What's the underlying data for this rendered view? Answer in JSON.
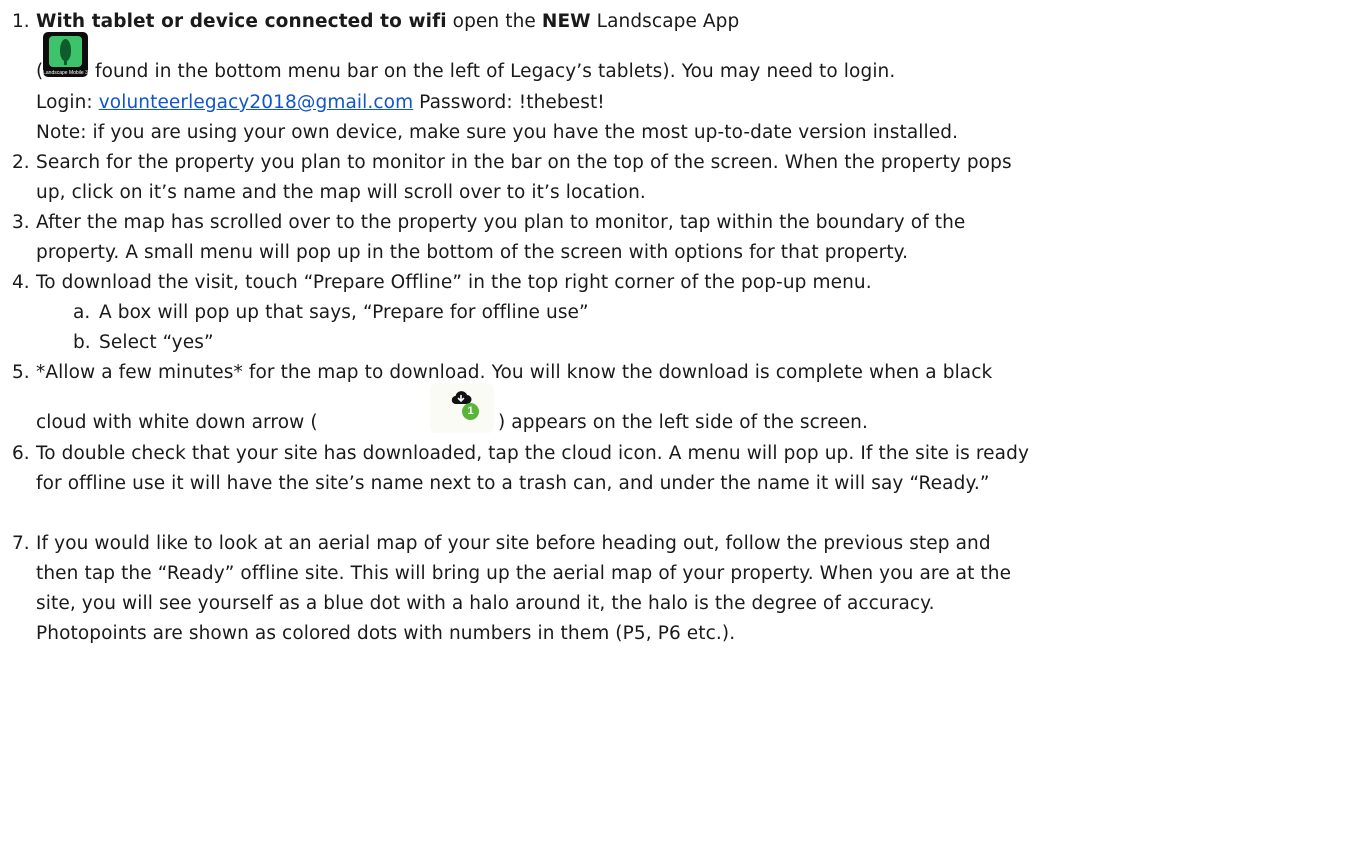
{
  "steps": [
    {
      "number": "1.",
      "lead_bold": "With tablet or device connected to wifi",
      "lead_rest": " open the ",
      "new_bold": "NEW",
      "lead_tail": " Landscape App",
      "icon_open": "(",
      "icon_line": "found in the bottom menu bar on the left of Legacy’s tablets). You may need to login.",
      "login_label": "Login: ",
      "login_email": "volunteerlegacy2018@gmail.com",
      "password_text": "  Password: !thebest!",
      "note": "Note: if you are using your own device, make sure you have the most up-to-date version installed."
    },
    {
      "number": "2.",
      "line1": "Search for the property you plan to monitor in the bar on the top of the screen. When the property pops",
      "line2": "up, click on it’s name and the map will scroll over to it’s location."
    },
    {
      "number": "3.",
      "line1": "After the map has scrolled over to the property you plan to monitor, tap within the boundary of the",
      "line2": "property. A small menu will pop up in the bottom of the screen with options for that property."
    },
    {
      "number": "4.",
      "line1": " To download the visit, touch “Prepare Offline” in the top right corner of the pop-up menu.",
      "sub": [
        {
          "letter": "a.",
          "text": "A box will pop up that says, “Prepare for offline use”"
        },
        {
          "letter": "b.",
          "text": "Select “yes”"
        }
      ]
    },
    {
      "number": "5.",
      "line1": "*Allow a few minutes* for the map to download. You will know the download is complete when a black",
      "line2_pre": "cloud with white down arrow (",
      "line2_post": ") appears on the left side of the screen."
    },
    {
      "number": "6.",
      "line1": "To double check that your site has downloaded, tap the cloud icon. A menu will pop up. If the site is ready",
      "line2": "for offline use it will have the site’s name next to a trash can, and under the name it will say “Ready.”"
    },
    {
      "number": "7.",
      "line1": "If you would like to look at an aerial map of your site before heading out, follow the previous step and",
      "line2": "then tap the “Ready” offline site.   This will bring up the aerial map of your property. When you are at the",
      "line3": "site, you will see yourself as a blue dot with a halo around it, the halo is the degree of accuracy.",
      "line4": "Photopoints are shown as colored dots with numbers in them (P5, P6 etc.)."
    }
  ],
  "icons": {
    "app_icon_caption": "Landscape Mobile 3",
    "download_badge": "1"
  },
  "colors": {
    "link": "#1155cc",
    "app_icon_green": "#3ec36a",
    "badge_green": "#59b43a"
  }
}
